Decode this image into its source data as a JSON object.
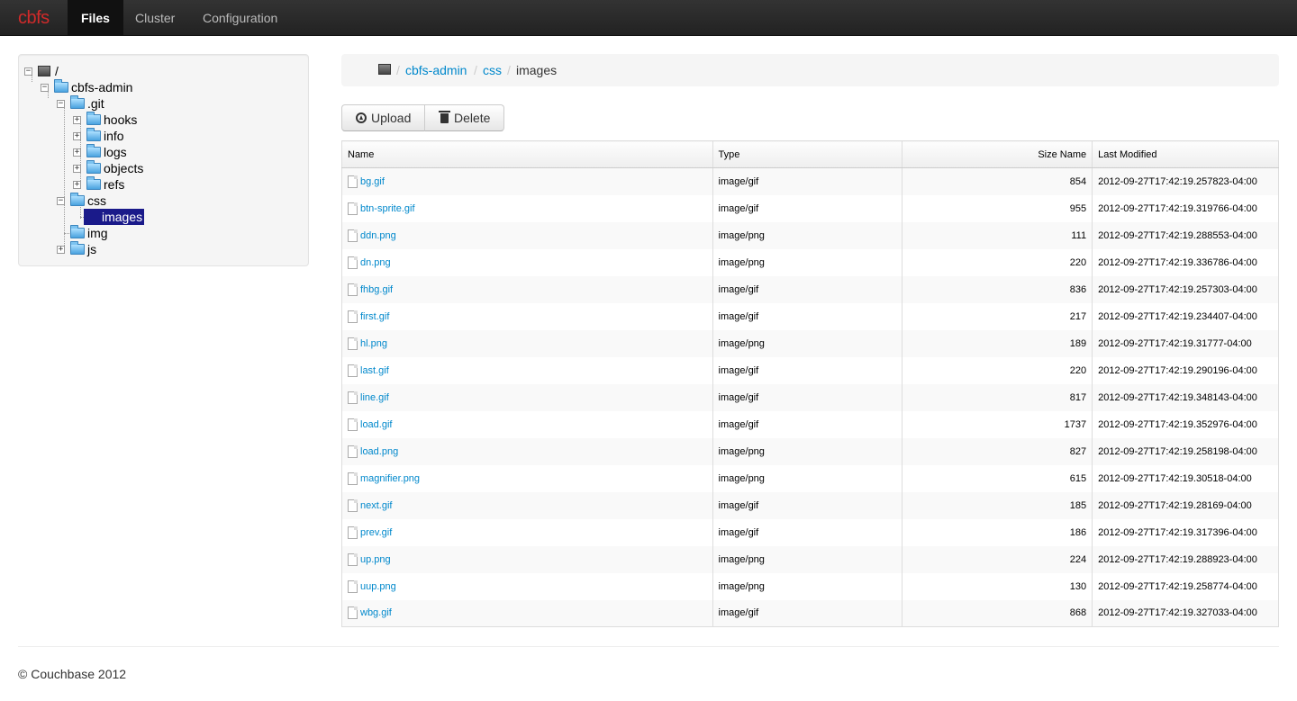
{
  "navbar": {
    "brand": "cbfs",
    "items": [
      {
        "label": "Files",
        "active": true
      },
      {
        "label": "Cluster",
        "active": false
      },
      {
        "label": "Configuration",
        "active": false
      }
    ]
  },
  "tree": {
    "root_label": "/",
    "nodes": [
      {
        "label": "cbfs-admin"
      },
      {
        "label": ".git"
      },
      {
        "label": "hooks"
      },
      {
        "label": "info"
      },
      {
        "label": "logs"
      },
      {
        "label": "objects"
      },
      {
        "label": "refs"
      },
      {
        "label": "css"
      },
      {
        "label": "images",
        "selected": true
      },
      {
        "label": "img"
      },
      {
        "label": "js"
      }
    ]
  },
  "breadcrumb": {
    "separator": "/",
    "links": [
      "cbfs-admin",
      "css"
    ],
    "current": "images"
  },
  "toolbar": {
    "upload_label": "Upload",
    "delete_label": "Delete"
  },
  "table": {
    "headers": [
      "Name",
      "Type",
      "Size Name",
      "Last Modified"
    ],
    "rows": [
      {
        "name": "bg.gif",
        "type": "image/gif",
        "size": "854",
        "modified": "2012-09-27T17:42:19.257823-04:00"
      },
      {
        "name": "btn-sprite.gif",
        "type": "image/gif",
        "size": "955",
        "modified": "2012-09-27T17:42:19.319766-04:00"
      },
      {
        "name": "ddn.png",
        "type": "image/png",
        "size": "111",
        "modified": "2012-09-27T17:42:19.288553-04:00"
      },
      {
        "name": "dn.png",
        "type": "image/png",
        "size": "220",
        "modified": "2012-09-27T17:42:19.336786-04:00"
      },
      {
        "name": "fhbg.gif",
        "type": "image/gif",
        "size": "836",
        "modified": "2012-09-27T17:42:19.257303-04:00"
      },
      {
        "name": "first.gif",
        "type": "image/gif",
        "size": "217",
        "modified": "2012-09-27T17:42:19.234407-04:00"
      },
      {
        "name": "hl.png",
        "type": "image/png",
        "size": "189",
        "modified": "2012-09-27T17:42:19.31777-04:00"
      },
      {
        "name": "last.gif",
        "type": "image/gif",
        "size": "220",
        "modified": "2012-09-27T17:42:19.290196-04:00"
      },
      {
        "name": "line.gif",
        "type": "image/gif",
        "size": "817",
        "modified": "2012-09-27T17:42:19.348143-04:00"
      },
      {
        "name": "load.gif",
        "type": "image/gif",
        "size": "1737",
        "modified": "2012-09-27T17:42:19.352976-04:00"
      },
      {
        "name": "load.png",
        "type": "image/png",
        "size": "827",
        "modified": "2012-09-27T17:42:19.258198-04:00"
      },
      {
        "name": "magnifier.png",
        "type": "image/png",
        "size": "615",
        "modified": "2012-09-27T17:42:19.30518-04:00"
      },
      {
        "name": "next.gif",
        "type": "image/gif",
        "size": "185",
        "modified": "2012-09-27T17:42:19.28169-04:00"
      },
      {
        "name": "prev.gif",
        "type": "image/gif",
        "size": "186",
        "modified": "2012-09-27T17:42:19.317396-04:00"
      },
      {
        "name": "up.png",
        "type": "image/png",
        "size": "224",
        "modified": "2012-09-27T17:42:19.288923-04:00"
      },
      {
        "name": "uup.png",
        "type": "image/png",
        "size": "130",
        "modified": "2012-09-27T17:42:19.258774-04:00"
      },
      {
        "name": "wbg.gif",
        "type": "image/gif",
        "size": "868",
        "modified": "2012-09-27T17:42:19.327033-04:00"
      }
    ]
  },
  "footer": {
    "text": "© Couchbase 2012"
  },
  "colors": {
    "brand": "#d12a2a",
    "link": "#0088cc",
    "selected": "#1a1a8a"
  }
}
